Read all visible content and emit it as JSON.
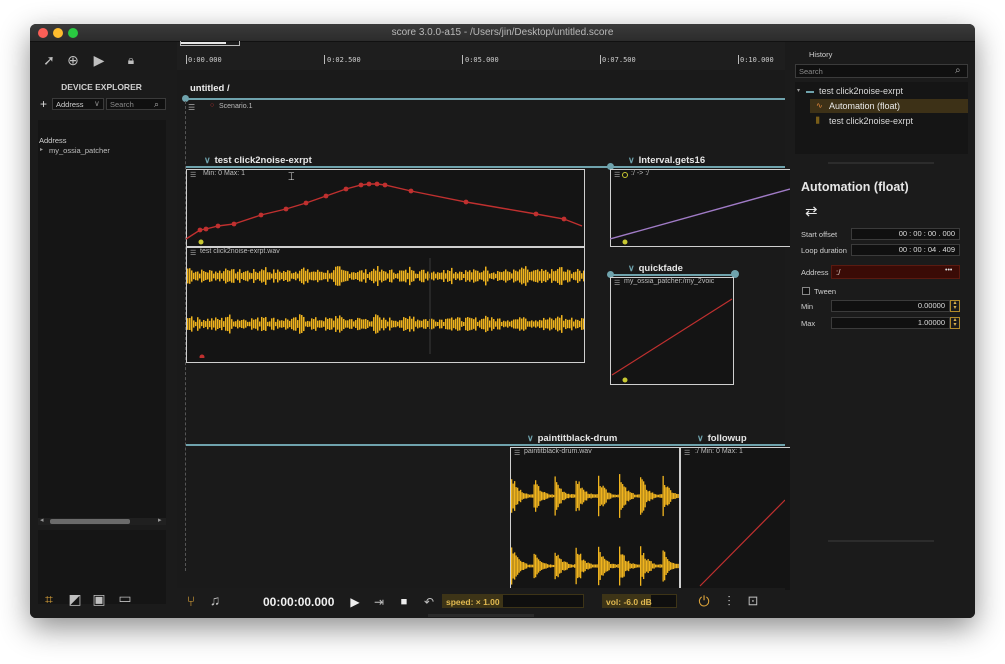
{
  "window": {
    "title": "score 3.0.0-a15 - /Users/jin/Desktop/untitled.score"
  },
  "left_panel": {
    "title": "DEVICE EXPLORER",
    "add_label": "+",
    "address_select": "Address",
    "search_placeholder": "Search",
    "column_header": "Address",
    "tree_item": "my_ossia_patcher"
  },
  "timeline": {
    "ticks": [
      "0:00.000",
      "0:02.500",
      "0:05.000",
      "0:07.500",
      "0:10.000"
    ],
    "breadcrumb": "untitled /",
    "scenario_label": "Scenario.1"
  },
  "intervals": {
    "click": {
      "title": "test click2noise-exrpt",
      "process_header": "Min: 0  Max: 1",
      "audio_header": "test click2noise-exrpt.wav"
    },
    "gets16": {
      "title": "Interval.gets16",
      "process_header": ":/ -> :/"
    },
    "quickfade": {
      "title": "quickfade",
      "process_header": "my_ossia_patcher:/my_2voic"
    },
    "paint": {
      "title": "paintitblack-drum",
      "process_header": "paintitblack-drum.wav"
    },
    "followup": {
      "title": "followup",
      "process_header": ":/  Min: 0  Max: 1"
    }
  },
  "history": {
    "title": "History",
    "search_placeholder": "Search",
    "items": [
      "test click2noise-exrpt",
      "Automation (float)",
      "test click2noise-exrpt"
    ]
  },
  "inspector": {
    "title": "Automation (float)",
    "start_offset_label": "Start offset",
    "start_offset_value": "00 : 00 : 00 .  000",
    "loop_duration_label": "Loop duration",
    "loop_duration_value": "00 : 00 : 04 .  409",
    "address_label": "Address",
    "address_value": ":/",
    "address_more": "•••",
    "tween_label": "Tween",
    "min_label": "Min",
    "min_value": "0.00000",
    "max_label": "Max",
    "max_value": "1.00000"
  },
  "transport": {
    "time": "00:00:00.000",
    "speed": "speed: × 1.00",
    "volume": "vol: -6.0 dB"
  },
  "colors": {
    "accent": "#6fa3ad",
    "automation_red": "#c0302f",
    "waveform_yellow": "#f0b41e",
    "purple_line": "#a07bc6",
    "history_selected": "#3d3117"
  },
  "icons": [
    "pointer-icon",
    "add-circle-icon",
    "play-icon",
    "lock-icon",
    "music-note-icon",
    "stop-icon",
    "power-icon",
    "mixer-icon",
    "console-icon"
  ]
}
